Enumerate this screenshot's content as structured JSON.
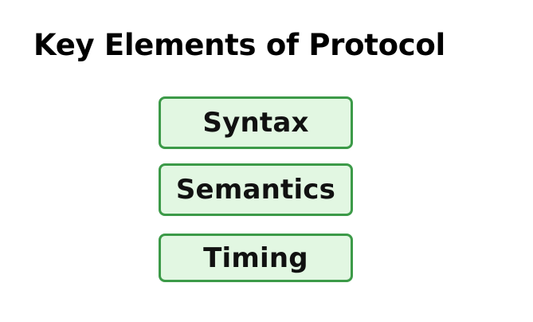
{
  "title": "Key Elements of Protocol",
  "elements": [
    {
      "label": "Syntax"
    },
    {
      "label": "Semantics"
    },
    {
      "label": "Timing"
    }
  ],
  "colors": {
    "box_border": "#3c9a48",
    "box_fill": "#e2f7e2",
    "text": "#111111"
  }
}
